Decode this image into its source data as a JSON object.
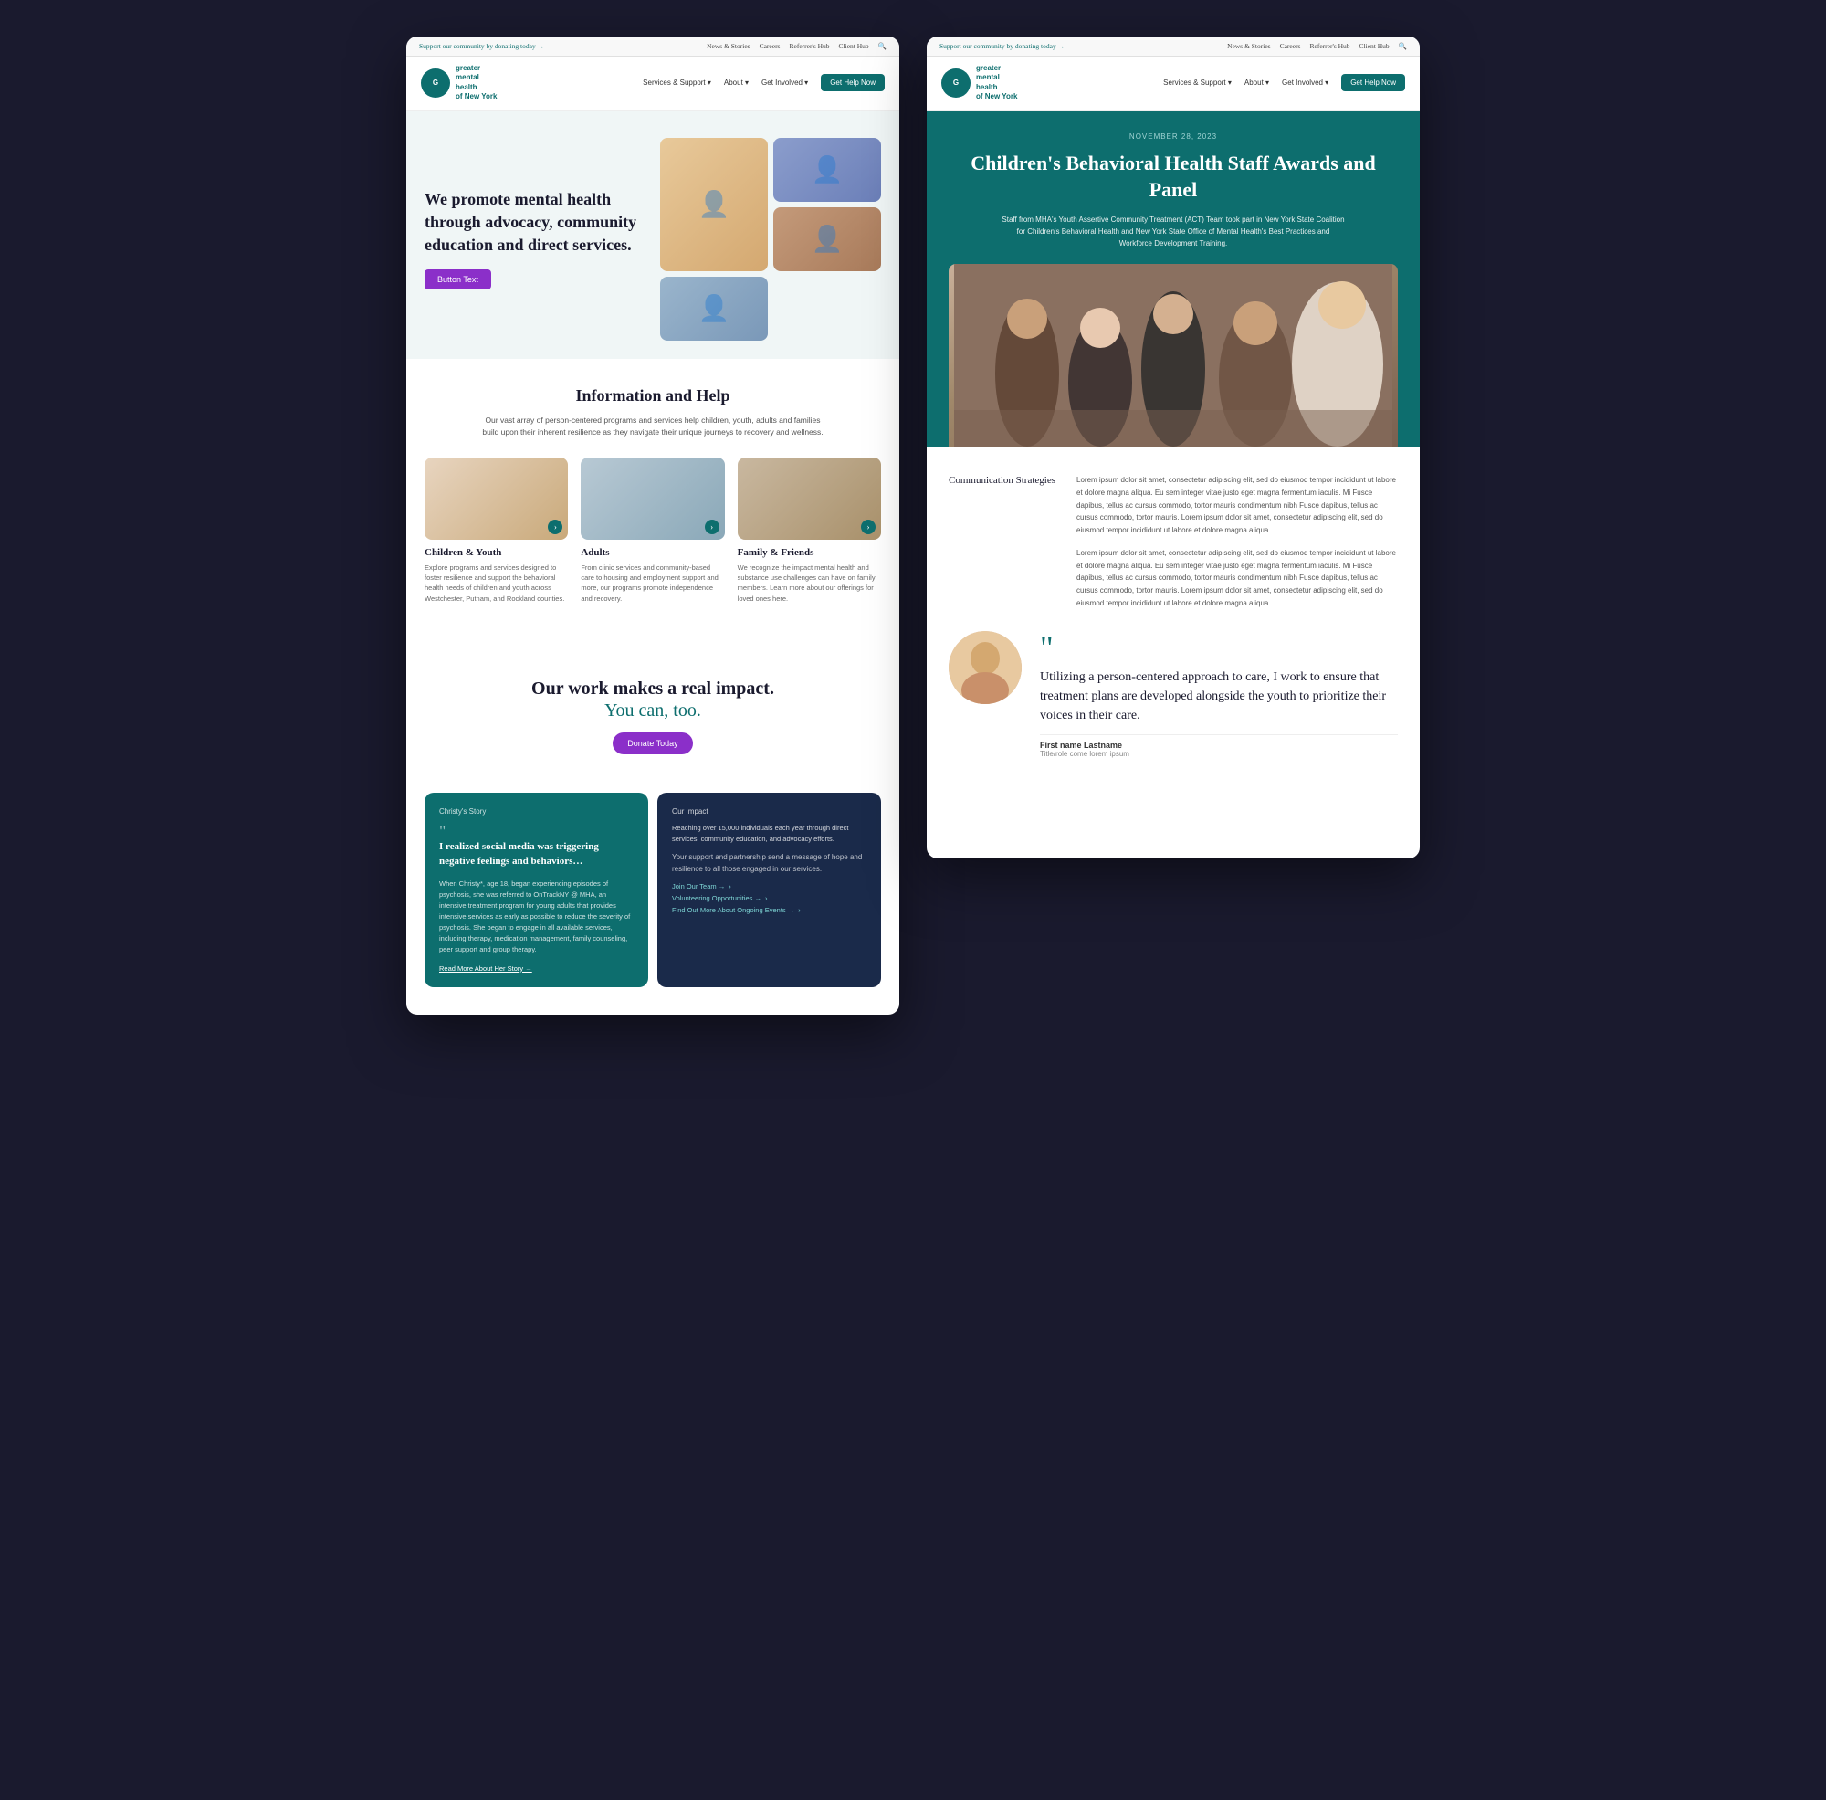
{
  "left": {
    "topbar": {
      "support_text": "Support our community by donating today →",
      "nav_links": [
        "News & Stories",
        "Careers",
        "Referrer's Hub",
        "Client Hub"
      ],
      "search_icon": "🔍"
    },
    "nav": {
      "logo_line1": "greater",
      "logo_line2": "mental",
      "logo_line3": "health",
      "logo_line4": "of New York",
      "services_label": "Services & Support ▾",
      "about_label": "About ▾",
      "get_involved_label": "Get Involved ▾",
      "get_help_label": "Get Help Now"
    },
    "hero": {
      "heading": "We promote mental health through advocacy, community education and direct services.",
      "button_label": "Button Text"
    },
    "info": {
      "heading": "Information and Help",
      "subtext": "Our vast array of person-centered programs and services help children, youth, adults and families build upon their inherent resilience as they navigate their unique journeys to recovery and wellness.",
      "cards": [
        {
          "title": "Children & Youth",
          "desc": "Explore programs and services designed to foster resilience and support the behavioral health needs of children and youth across Westchester, Putnam, and Rockland counties."
        },
        {
          "title": "Adults",
          "desc": "From clinic services and community-based care to housing and employment support and more, our programs promote independence and recovery."
        },
        {
          "title": "Family & Friends",
          "desc": "We recognize the impact mental health and substance use challenges can have on family members. Learn more about our offerings for loved ones here."
        }
      ]
    },
    "impact": {
      "line1": "Our work makes a real impact.",
      "line2": "You can, too.",
      "donate_label": "Donate Today"
    },
    "stories": {
      "christy_label": "Christy's Story",
      "christy_quote": "I realized social media was triggering negative feelings and behaviors…",
      "christy_body": "When Christy*, age 18, began experiencing episodes of psychosis, she was referred to OnTrackNY @ MHA, an intensive treatment program for young adults that provides intensive services as early as possible to reduce the severity of psychosis. She began to engage in all available services, including therapy, medication management, family counseling, peer support and group therapy.",
      "christy_link": "Read More About Her Story →",
      "impact_label": "Our Impact",
      "impact_text": "Reaching over 15,000 individuals each year through direct services, community education, and advocacy efforts.",
      "impact_support": "Your support and partnership send a message of hope and resilience to all those engaged in our services.",
      "link1": "Join Our Team →",
      "link2": "Volunteering Opportunities →",
      "link3": "Find Out More About Ongoing Events →"
    }
  },
  "right": {
    "topbar": {
      "support_text": "Support our community by donating today →",
      "nav_links": [
        "News & Stories",
        "Careers",
        "Referrer's Hub",
        "Client Hub"
      ],
      "search_icon": "🔍"
    },
    "nav": {
      "logo_line1": "greater",
      "logo_line2": "mental",
      "logo_line3": "health",
      "logo_line4": "of New York",
      "services_label": "Services & Support ▾",
      "about_label": "About ▾",
      "get_involved_label": "Get Involved ▾",
      "get_help_label": "Get Help Now"
    },
    "article": {
      "date": "NOVEMBER 28, 2023",
      "title": "Children's Behavioral Health Staff Awards and Panel",
      "desc": "Staff from MHA's Youth Assertive Community Treatment (ACT) Team took part in New York State Coalition for Children's Behavioral Health and New York State Office of Mental Health's Best Practices and Workforce Development Training."
    },
    "comm_strategies": {
      "label": "Communication Strategies",
      "para1": "Lorem ipsum dolor sit amet, consectetur adipiscing elit, sed do eiusmod tempor incididunt ut labore et dolore magna aliqua. Eu sem integer vitae justo eget magna fermentum iaculis. Mi Fusce dapibus, tellus ac cursus commodo, tortor mauris condimentum nibh Fusce dapibus, tellus ac cursus commodo, tortor mauris. Lorem ipsum dolor sit amet, consectetur adipiscing elit, sed do eiusmod tempor incididunt ut labore et dolore magna aliqua.",
      "para2": "Lorem ipsum dolor sit amet, consectetur adipiscing elit, sed do eiusmod tempor incididunt ut labore et dolore magna aliqua. Eu sem integer vitae justo eget magna fermentum iaculis. Mi Fusce dapibus, tellus ac cursus commodo, tortor mauris condimentum nibh Fusce dapibus, tellus ac cursus commodo, tortor mauris. Lorem ipsum dolor sit amet, consectetur adipiscing elit, sed do eiusmod tempor incididunt ut labore et dolore magna aliqua."
    },
    "testimonial": {
      "quote": "Utilizing a person-centered approach to care, I work to ensure that treatment plans are developed alongside the youth to prioritize their voices in their care.",
      "name": "First name Lastname",
      "role": "Title/role come lorem ipsum"
    }
  }
}
